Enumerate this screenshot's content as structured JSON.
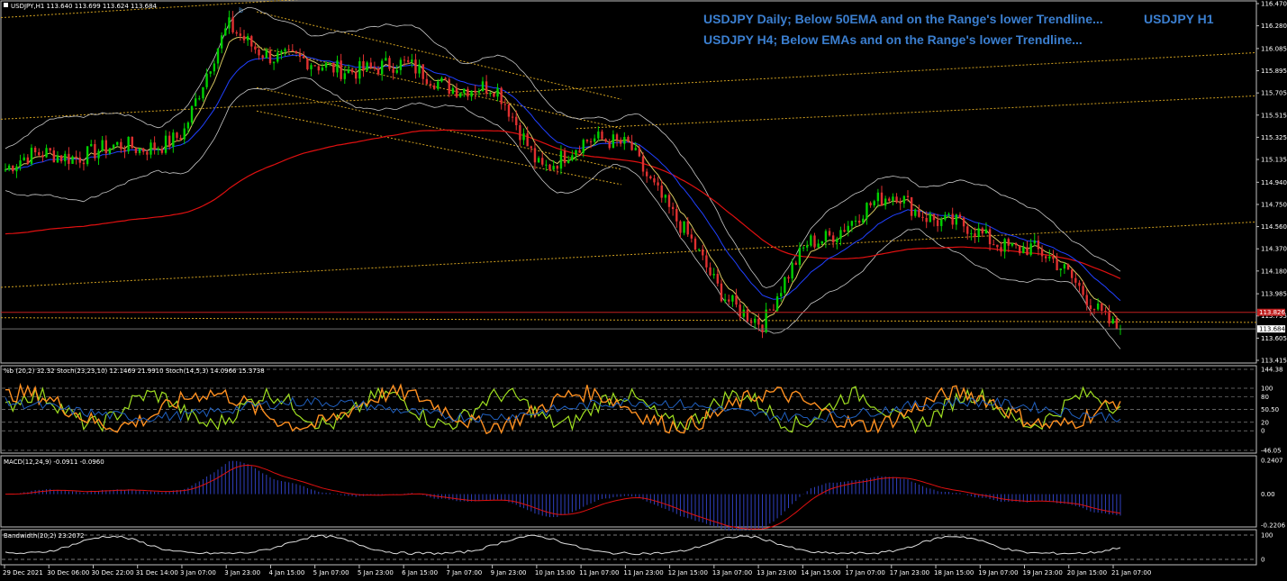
{
  "window": {
    "symbol_header": "USDJPY,H1  113.640 113.699 113.624 113.684"
  },
  "annotations": {
    "line1": "USDJPY Daily; Below 50EMA and on the Range's lower Trendline...",
    "line2": "USDJPY H4; Below EMAs and on the Range's lower Trendline...",
    "timeframe": "USDJPY H1",
    "peak_marker": "b"
  },
  "price_axis": {
    "ticks": [
      "116.470",
      "116.280",
      "116.085",
      "115.895",
      "115.705",
      "115.515",
      "115.325",
      "115.135",
      "114.940",
      "114.750",
      "114.560",
      "114.370",
      "114.180",
      "113.985",
      "113.795",
      "113.605",
      "113.415"
    ],
    "tag_red": "113.826",
    "tag_current": "113.684"
  },
  "time_axis": {
    "labels": [
      "29 Dec 2021",
      "30 Dec 06:00",
      "30 Dec 22:00",
      "31 Dec 14:00",
      "3 Jan 07:00",
      "3 Jan 23:00",
      "4 Jan 15:00",
      "5 Jan 07:00",
      "5 Jan 23:00",
      "6 Jan 15:00",
      "7 Jan 07:00",
      "9 Jan 23:00",
      "10 Jan 15:00",
      "11 Jan 07:00",
      "11 Jan 23:00",
      "12 Jan 15:00",
      "13 Jan 07:00",
      "13 Jan 23:00",
      "14 Jan 15:00",
      "17 Jan 07:00",
      "17 Jan 23:00",
      "18 Jan 15:00",
      "19 Jan 07:00",
      "19 Jan 23:00",
      "20 Jan 15:00",
      "21 Jan 07:00"
    ]
  },
  "subwindows": {
    "stoch": {
      "label": "%b (20,2) 32.32  Stoch(23,23,10) 12.1469 21.9910  Stoch(14,5,3) 14.0966 15.3738",
      "ticks": [
        "144.38",
        "100",
        "80",
        "50.50",
        "20",
        "0",
        "-46.05"
      ]
    },
    "macd": {
      "label": "MACD(12,24,9) -0.0911 -0.0960",
      "ticks": [
        "0.2407",
        "0.00",
        "-0.2206"
      ]
    },
    "bandwidth": {
      "label": "Bandwidth(20,2) 23.2072",
      "ticks": [
        "100",
        "0"
      ]
    }
  },
  "colors": {
    "background": "#000000",
    "bull_candle": "#00d000",
    "bear_candle": "#e03030",
    "ema_slow": "#e01010",
    "ema_mid": "#2040ff",
    "ema_fast": "#d8c860",
    "bollinger": "#c8c8c8",
    "trendline": "#d0a020",
    "grid": "#ffffff",
    "annotation": "#3b7fd0"
  },
  "chart_data": {
    "type": "line",
    "symbol": "USDJPY",
    "timeframe": "H1",
    "x": [
      "29 Dec 2021",
      "30 Dec 06:00",
      "30 Dec 22:00",
      "31 Dec 14:00",
      "3 Jan 07:00",
      "3 Jan 23:00",
      "4 Jan 15:00",
      "5 Jan 07:00",
      "5 Jan 23:00",
      "6 Jan 15:00",
      "7 Jan 07:00",
      "9 Jan 23:00",
      "10 Jan 15:00",
      "11 Jan 07:00",
      "11 Jan 23:00",
      "12 Jan 15:00",
      "13 Jan 07:00",
      "13 Jan 23:00",
      "14 Jan 15:00",
      "17 Jan 07:00",
      "17 Jan 23:00",
      "18 Jan 15:00",
      "19 Jan 07:00",
      "19 Jan 23:00",
      "20 Jan 15:00",
      "21 Jan 07:00"
    ],
    "series": [
      {
        "name": "USDJPY,H1",
        "values": [
          115.05,
          115.18,
          115.22,
          115.2,
          115.4,
          116.25,
          116.05,
          115.9,
          115.95,
          115.9,
          115.8,
          115.7,
          115.1,
          115.25,
          115.3,
          114.6,
          114.05,
          113.7,
          114.45,
          114.6,
          114.85,
          114.6,
          114.45,
          114.4,
          114.05,
          113.7
        ]
      }
    ],
    "ylim": [
      113.415,
      116.47
    ],
    "last": {
      "open": 113.64,
      "high": 113.699,
      "low": 113.624,
      "close": 113.684
    }
  }
}
